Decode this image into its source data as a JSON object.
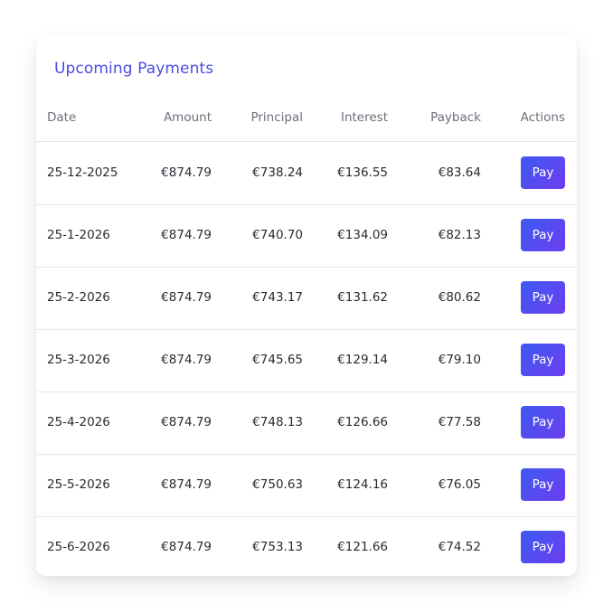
{
  "card": {
    "title": "Upcoming Payments"
  },
  "table": {
    "headers": {
      "date": "Date",
      "amount": "Amount",
      "principal": "Principal",
      "interest": "Interest",
      "payback": "Payback",
      "actions": "Actions"
    },
    "rows": [
      {
        "date": "25-12-2025",
        "amount": "€874.79",
        "principal": "€738.24",
        "interest": "€136.55",
        "payback": "€83.64",
        "action": "Pay"
      },
      {
        "date": "25-1-2026",
        "amount": "€874.79",
        "principal": "€740.70",
        "interest": "€134.09",
        "payback": "€82.13",
        "action": "Pay"
      },
      {
        "date": "25-2-2026",
        "amount": "€874.79",
        "principal": "€743.17",
        "interest": "€131.62",
        "payback": "€80.62",
        "action": "Pay"
      },
      {
        "date": "25-3-2026",
        "amount": "€874.79",
        "principal": "€745.65",
        "interest": "€129.14",
        "payback": "€79.10",
        "action": "Pay"
      },
      {
        "date": "25-4-2026",
        "amount": "€874.79",
        "principal": "€748.13",
        "interest": "€126.66",
        "payback": "€77.58",
        "action": "Pay"
      },
      {
        "date": "25-5-2026",
        "amount": "€874.79",
        "principal": "€750.63",
        "interest": "€124.16",
        "payback": "€76.05",
        "action": "Pay"
      },
      {
        "date": "25-6-2026",
        "amount": "€874.79",
        "principal": "€753.13",
        "interest": "€121.66",
        "payback": "€74.52",
        "action": "Pay"
      }
    ]
  },
  "colors": {
    "title": "#4a4de0",
    "button_gradient_start": "#3d5af1",
    "button_gradient_end": "#6d3df0",
    "row_divider": "#e8e8ec"
  }
}
